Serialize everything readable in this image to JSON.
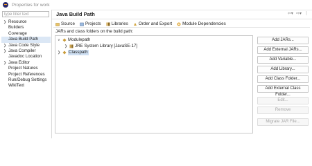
{
  "window": {
    "title": "Properties for work"
  },
  "left": {
    "filter_placeholder": "type filter text",
    "items": [
      {
        "label": "Resource",
        "expandable": true
      },
      {
        "label": "Builders",
        "expandable": false
      },
      {
        "label": "Coverage",
        "expandable": false
      },
      {
        "label": "Java Build Path",
        "expandable": false,
        "selected": true
      },
      {
        "label": "Java Code Style",
        "expandable": true
      },
      {
        "label": "Java Compiler",
        "expandable": true
      },
      {
        "label": "Javadoc Location",
        "expandable": false
      },
      {
        "label": "Java Editor",
        "expandable": true
      },
      {
        "label": "Project Natures",
        "expandable": false
      },
      {
        "label": "Project References",
        "expandable": false
      },
      {
        "label": "Run/Debug Settings",
        "expandable": false
      },
      {
        "label": "WikiText",
        "expandable": false
      }
    ]
  },
  "main": {
    "title": "Java Build Path",
    "tabs": [
      {
        "label": "Source",
        "icon": "source-folder-icon"
      },
      {
        "label": "Projects",
        "icon": "project-icon"
      },
      {
        "label": "Libraries",
        "icon": "libraries-icon",
        "active": true
      },
      {
        "label": "Order and Export",
        "icon": "order-export-icon"
      },
      {
        "label": "Module Dependencies",
        "icon": "module-icon"
      }
    ],
    "jar_label": "JARs and class folders on the build path:",
    "tree": [
      {
        "label": "Modulepath",
        "level": 0,
        "expanded": true
      },
      {
        "label": "JRE System Library [JavaSE-17]",
        "level": 1,
        "expanded": false
      },
      {
        "label": "Classpath",
        "level": 0,
        "expanded": false,
        "selected": true
      }
    ],
    "buttons": [
      {
        "label": "Add JARs...",
        "enabled": true
      },
      {
        "label": "Add External JARs...",
        "enabled": true
      },
      {
        "label": "Add Variable...",
        "enabled": true
      },
      {
        "label": "Add Library...",
        "enabled": true
      },
      {
        "label": "Add Class Folder...",
        "enabled": true
      },
      {
        "label": "Add External Class Folder...",
        "enabled": true
      },
      {
        "label": "Edit...",
        "enabled": false
      },
      {
        "label": "Remove",
        "enabled": false
      },
      {
        "label": "Migrate JAR File...",
        "enabled": false
      }
    ]
  },
  "colors": {
    "selection": "#dbe7f5",
    "library_icon": "#c99b3b"
  }
}
